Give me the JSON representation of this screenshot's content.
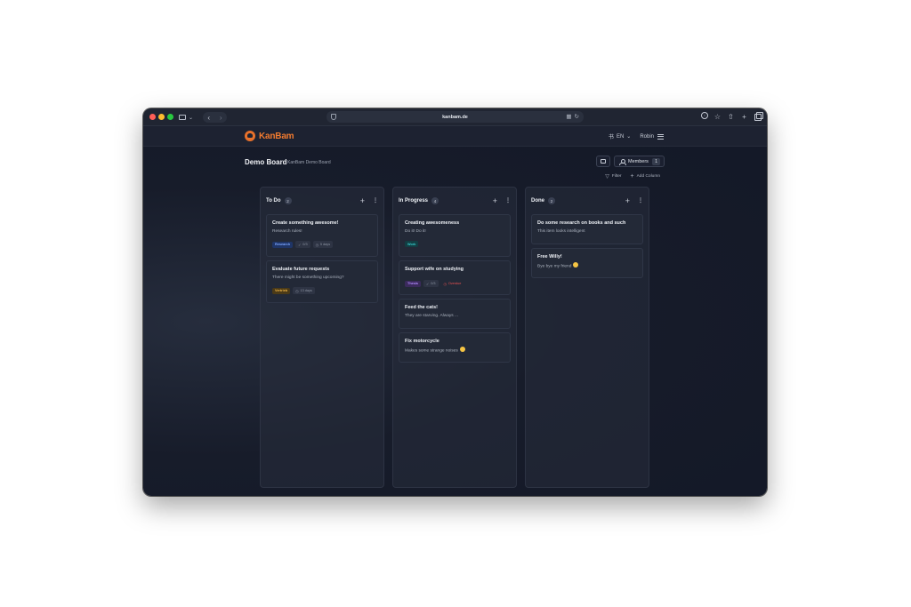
{
  "browser": {
    "url": "kanbam.de"
  },
  "app": {
    "logo_text": "KanBam",
    "language": "EN",
    "user": "Robin"
  },
  "board": {
    "title": "Demo Board",
    "subtitle": "KanBam Demo Board",
    "members_label": "Members",
    "members_count": "1",
    "filter_label": "Filter",
    "add_column_label": "Add Column"
  },
  "columns": [
    {
      "title": "To Do",
      "count": "2",
      "cards": [
        {
          "title": "Create something awesome!",
          "desc": "Research rules!",
          "tag": "Research",
          "checklist": "0/3",
          "due": "5 days"
        },
        {
          "title": "Evaluate future requests",
          "desc": "There might be something upcoming?",
          "tag": "Vertrieb",
          "due": "13 days"
        }
      ]
    },
    {
      "title": "In Progress",
      "count": "4",
      "cards": [
        {
          "title": "Creating awesomeness",
          "desc": "Do it! Do it!",
          "tag": "Work"
        },
        {
          "title": "Support wife on studying",
          "desc": "",
          "tag": "Thesis",
          "checklist": "0/3",
          "due": "Overdue"
        },
        {
          "title": "Feed the cats!",
          "desc": "They are starving. Always ..."
        },
        {
          "title": "Fix motorcycle",
          "desc": "Makes some strange noises"
        }
      ]
    },
    {
      "title": "Done",
      "count": "2",
      "cards": [
        {
          "title": "Do some research on books and such",
          "desc": "This item looks intelligent"
        },
        {
          "title": "Free Willy!",
          "desc": "Bye bye my friend"
        }
      ]
    }
  ],
  "colors": {
    "accent": "#f07a2f",
    "background": "#171c2a",
    "card": "#232937"
  }
}
